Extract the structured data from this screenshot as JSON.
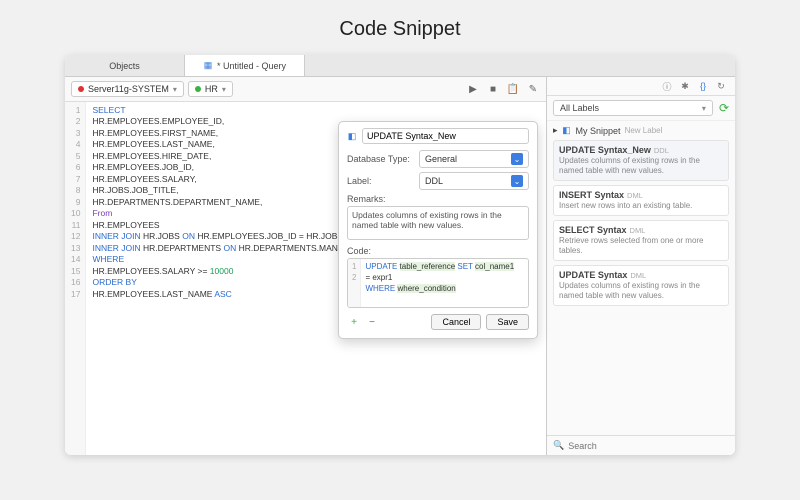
{
  "page_title": "Code Snippet",
  "tabs": {
    "objects": "Objects",
    "query_tab": "* Untitled - Query"
  },
  "connbar": {
    "server": "Server11g-SYSTEM",
    "schema": "HR"
  },
  "editor_lines": [
    {
      "n": 1,
      "t": "SELECT",
      "cls": "kw"
    },
    {
      "n": 2,
      "t": "HR.EMPLOYEES.EMPLOYEE_ID,"
    },
    {
      "n": 3,
      "t": "HR.EMPLOYEES.FIRST_NAME,"
    },
    {
      "n": 4,
      "t": "HR.EMPLOYEES.LAST_NAME,"
    },
    {
      "n": 5,
      "t": "HR.EMPLOYEES.HIRE_DATE,"
    },
    {
      "n": 6,
      "t": "HR.EMPLOYEES.JOB_ID,"
    },
    {
      "n": 7,
      "t": "HR.EMPLOYEES.SALARY,"
    },
    {
      "n": 8,
      "t": "HR.JOBS.JOB_TITLE,"
    },
    {
      "n": 9,
      "t": "HR.DEPARTMENTS.DEPARTMENT_NAME,"
    },
    {
      "n": 10,
      "t": "From",
      "cls": "kw2"
    },
    {
      "n": 11,
      "t": "HR.EMPLOYEES"
    },
    {
      "n": 12,
      "html": "<span class='kw'>INNER JOIN</span> HR.JOBS <span class='kw'>ON</span> HR.EMPLOYEES.JOB_ID = HR.JOBS.JOB_ID"
    },
    {
      "n": 13,
      "html": "<span class='kw'>INNER JOIN</span> HR.DEPARTMENTS <span class='kw'>ON</span> HR.DEPARTMENTS.MANAGER_ID = HR.DEPARTMENTS.DEPARTMENT_ID"
    },
    {
      "n": 14,
      "t": "WHERE",
      "cls": "kw"
    },
    {
      "n": 15,
      "html": "HR.EMPLOYEES.SALARY >= <span class='num'>10000</span>"
    },
    {
      "n": 16,
      "t": "ORDER BY",
      "cls": "kw"
    },
    {
      "n": 17,
      "html": "HR.EMPLOYEES.LAST_NAME <span class='kw'>ASC</span>"
    }
  ],
  "dlg": {
    "name": "UPDATE Syntax_New",
    "db_type_label": "Database Type:",
    "db_type_value": "General",
    "label_label": "Label:",
    "label_value": "DDL",
    "remarks_label": "Remarks:",
    "remarks_value": "Updates columns of existing rows in the named table with new values.",
    "code_label": "Code:",
    "code_lines": [
      {
        "n": 1,
        "html": "<span class='kw'>UPDATE</span> <span class='hl'>table_reference</span> <span class='kw'>SET</span> <span class='hl'>col_name1</span>"
      },
      {
        "n": "",
        "html": "= expr1"
      },
      {
        "n": 2,
        "html": "<span class='kw'>WHERE</span> <span class='hl'>where_condition</span>"
      }
    ],
    "cancel": "Cancel",
    "save": "Save"
  },
  "side": {
    "labels": "All Labels",
    "header": "My Snippet",
    "new_label": "New Label",
    "items": [
      {
        "title": "UPDATE Syntax_New",
        "tag": "DDL",
        "desc": "Updates columns of existing rows in the named table with new values.",
        "sel": true
      },
      {
        "title": "INSERT Syntax",
        "tag": "DML",
        "desc": "Insert new rows into an existing table."
      },
      {
        "title": "SELECT Syntax",
        "tag": "DML",
        "desc": "Retrieve rows selected from one or more tables."
      },
      {
        "title": "UPDATE Syntax",
        "tag": "DML",
        "desc": "Updates columns of existing rows in the named table with new values."
      }
    ],
    "search_placeholder": "Search"
  }
}
